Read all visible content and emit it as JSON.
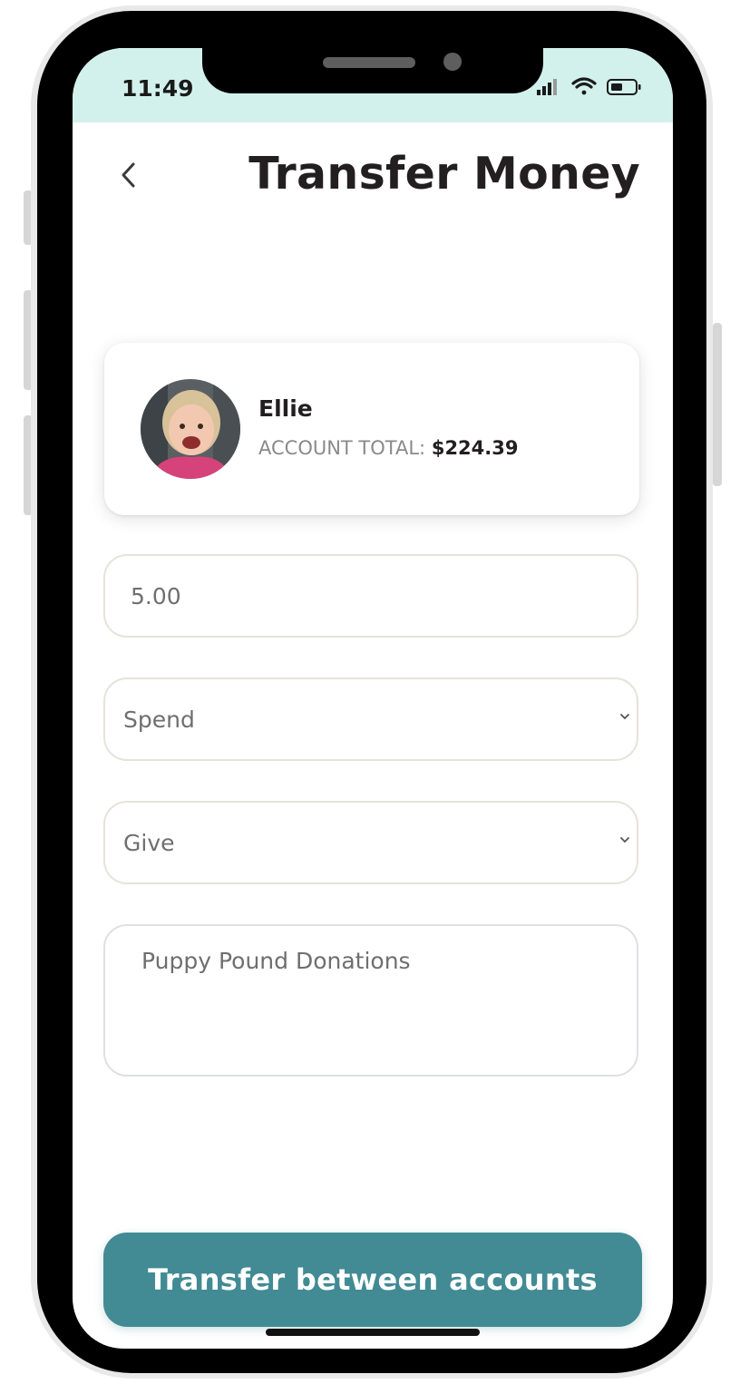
{
  "status_bar": {
    "time": "11:49"
  },
  "header": {
    "title": "Transfer Money",
    "back_icon": "chevron-left-icon"
  },
  "account_card": {
    "name": "Ellie",
    "total_label": "ACCOUNT TOTAL:",
    "total_value": "$224.39"
  },
  "form": {
    "amount_value": "5.00",
    "from_account": "Spend",
    "to_account": "Give",
    "memo_text": "Puppy Pound Donations"
  },
  "actions": {
    "transfer_label": "Transfer between accounts"
  },
  "colors": {
    "accent": "#428b94",
    "status_bar": "#d3f1ec",
    "title": "#231f20"
  }
}
